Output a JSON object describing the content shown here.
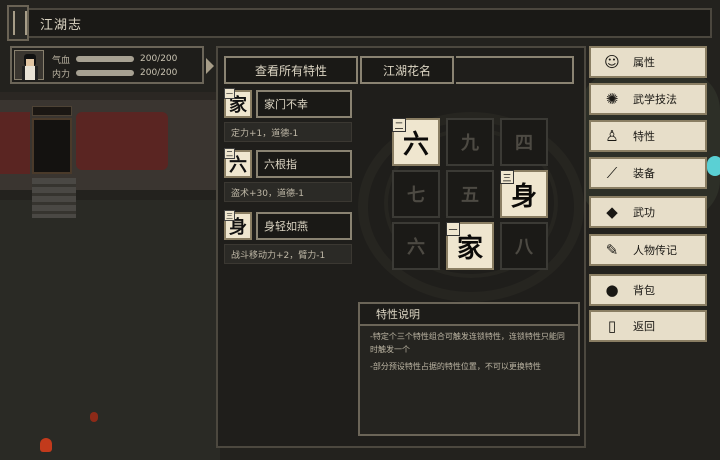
{
  "window": {
    "title": "江湖志"
  },
  "character": {
    "hp_label": "气血",
    "hp_value": "200/200",
    "hp_fill": 1.0,
    "mp_label": "内力",
    "mp_value": "200/200",
    "mp_fill": 1.0
  },
  "tabs": {
    "view_all": "查看所有特性",
    "nickname": "江湖花名"
  },
  "traits": [
    {
      "glyph": "家",
      "index": "一",
      "name": "家门不幸",
      "effect": "定力+1，道德-1"
    },
    {
      "glyph": "六",
      "index": "二",
      "name": "六根指",
      "effect": "盗术+30，道德-1"
    },
    {
      "glyph": "身",
      "index": "三",
      "name": "身轻如燕",
      "effect": "战斗移动力+2，臂力-1"
    }
  ],
  "grid": {
    "cells": [
      {
        "char": "六",
        "active": true,
        "index": "二"
      },
      {
        "char": "九",
        "active": false,
        "index": ""
      },
      {
        "char": "四",
        "active": false,
        "index": ""
      },
      {
        "char": "七",
        "active": false,
        "index": ""
      },
      {
        "char": "五",
        "active": false,
        "index": ""
      },
      {
        "char": "身",
        "active": true,
        "index": "三"
      },
      {
        "char": "六",
        "active": false,
        "index": ""
      },
      {
        "char": "家",
        "active": true,
        "index": "一"
      },
      {
        "char": "八",
        "active": false,
        "index": ""
      }
    ]
  },
  "description": {
    "title": "特性说明",
    "lines": [
      "-特定个三个特性组合可触发连锁特性，连锁特性只能同时触发一个",
      "-部分预设特性占据的特性位置，不可以更换特性"
    ]
  },
  "menu": {
    "items": [
      {
        "label": "属性",
        "icon": "person-icon"
      },
      {
        "label": "武学技法",
        "icon": "martial-figure-icon"
      },
      {
        "label": "特性",
        "icon": "trait-icon"
      },
      {
        "label": "装备",
        "icon": "sword-icon"
      },
      {
        "label": "武功",
        "icon": "scroll-book-icon"
      },
      {
        "label": "人物传记",
        "icon": "biography-book-icon"
      },
      {
        "label": "背包",
        "icon": "bag-icon"
      },
      {
        "label": "返回",
        "icon": "door-icon"
      }
    ]
  }
}
